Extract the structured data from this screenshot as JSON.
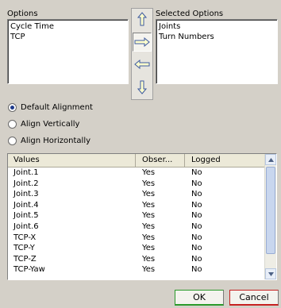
{
  "options": {
    "label": "Options",
    "items": [
      "Cycle Time",
      "TCP"
    ]
  },
  "selected_options": {
    "label": "Selected Options",
    "items": [
      "Joints",
      "Turn Numbers"
    ]
  },
  "transfer_buttons": {
    "up_icon": "arrow-up-icon",
    "right_icon": "arrow-right-icon",
    "left_icon": "arrow-left-icon",
    "down_icon": "arrow-down-icon",
    "arrow_fill": "#ffffcc",
    "arrow_stroke": "#3c5aa0"
  },
  "alignment": {
    "options": [
      {
        "label": "Default Alignment",
        "checked": true
      },
      {
        "label": "Align Vertically",
        "checked": false
      },
      {
        "label": "Align Horizontally",
        "checked": false
      }
    ]
  },
  "table": {
    "columns": [
      "Values",
      "Obser...",
      "Logged"
    ],
    "rows": [
      [
        "Joint.1",
        "Yes",
        "No"
      ],
      [
        "Joint.2",
        "Yes",
        "No"
      ],
      [
        "Joint.3",
        "Yes",
        "No"
      ],
      [
        "Joint.4",
        "Yes",
        "No"
      ],
      [
        "Joint.5",
        "Yes",
        "No"
      ],
      [
        "Joint.6",
        "Yes",
        "No"
      ],
      [
        "TCP-X",
        "Yes",
        "No"
      ],
      [
        "TCP-Y",
        "Yes",
        "No"
      ],
      [
        "TCP-Z",
        "Yes",
        "No"
      ],
      [
        "TCP-Yaw",
        "Yes",
        "No"
      ]
    ]
  },
  "buttons": {
    "ok": "OK",
    "cancel": "Cancel",
    "ok_accent": "#2b9a2b",
    "cancel_accent": "#c62020"
  }
}
